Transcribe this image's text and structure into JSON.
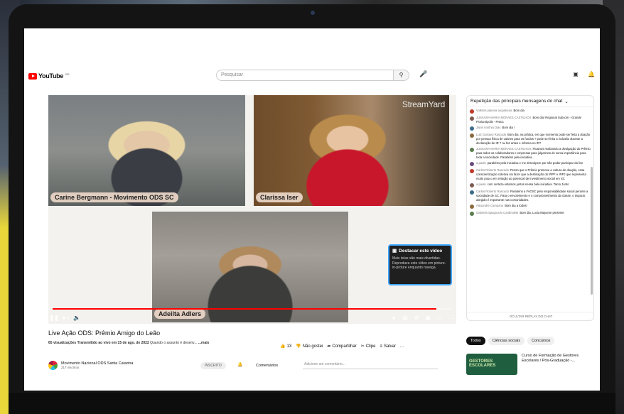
{
  "header": {
    "logo_text": "YouTube",
    "logo_region": "BR",
    "search_placeholder": "Pesquisar"
  },
  "player": {
    "participants": [
      {
        "name": "Carine Bergmann - Movimento ODS SC"
      },
      {
        "name": "Clarissa Iser"
      },
      {
        "name": "Adeilta Adlers"
      }
    ],
    "brand_watermark": "StreamYard",
    "progress_fraction": 0.96,
    "miniplayer_tip": {
      "title": "Destacar este vídeo",
      "body": "Mais telas são mais divertidas. Reproduza este vídeo em picture-in-picture enquanto navega."
    }
  },
  "chat": {
    "header": "Repetição das principais mensagens do chat",
    "messages": [
      {
        "author": "Volkmis planeta arquitetura",
        "text": "Bom dia"
      },
      {
        "author": "JUSSARA MARIA MORAES CASTILHOS",
        "text": "Bom dia! Regional Subcom - Grande Florianópolis - FNSC"
      },
      {
        "author": "Jamil Antônio Dias",
        "text": "Bom dia !"
      },
      {
        "author": "Luiz Gustavo Rascado",
        "text": "Bom dia, na prática, em que momento pode ser feita a doação por pessoa física de valores para os fundos ? pode ser feita a inclusão durante a declaração de IR ? ou faz antes e informa no IR?"
      },
      {
        "author": "JUSSARA MARIA MORAES CASTILHOS",
        "text": "Ficamos realizando a divulgação do Prêmio para todos os colaboradores e empresas para julgarmos de suma importância para toda a sociedade. Parabéns pela iniciativa."
      },
      {
        "author": "a paulo",
        "text": "parabéns pela iniciativa e me desculpem por não poder participar da live"
      },
      {
        "author": "Carlos Roberto Rascado",
        "text": "Penso que o Prêmio promove a cultura de doação, essa conscientização coletiva vai fazer que a destinação do IRPF e IRPJ que representa muito pouco em relação ao potencial de investimento social em SC"
      },
      {
        "author": "a paulo",
        "text": "com certeza estamos juntos nessa bela iniciativa. Tamo Junto"
      },
      {
        "author": "Carlos Roberto Rascado",
        "text": "Parabéns a FAOSC pela responsabilidade social perante a sociedade de SC. Para o envolvimento e o comprometimento da classe, o impacto atingido é importante nas comunidades."
      },
      {
        "author": "Alexandre Campana",
        "text": "Bom dia a todos!"
      },
      {
        "author": "Gabriela Spagnuolo Cardinaletti",
        "text": "Bom dia, Lucia Mayume presente"
      }
    ],
    "footer": "OCULTAR REPLAY DO CHAT"
  },
  "video": {
    "title": "Live Ação ODS: Prêmio Amigo do Leão",
    "views": "65 visualizações",
    "date": "Transmitido ao vivo em 15 de ago. de 2022",
    "description_snippet": "Quando o assunto é desenv...",
    "more_label": "...mais",
    "likes": "13",
    "dislike_label": "Não gostei",
    "share_label": "Compartilhar",
    "clip_label": "Clipe",
    "save_label": "Salvar",
    "more_actions": "..."
  },
  "channel": {
    "name": "Movimento Nacional ODS Santa Catarina",
    "subscribers": "217 inscritos",
    "subscribe_label": "INSCRITO",
    "comments_label": "Comentários",
    "comment_placeholder": "Adicione um comentário..."
  },
  "sidebar": {
    "chips": [
      "Todos",
      "Ciências sociais",
      "Concursos"
    ],
    "recommended": {
      "thumb_text": "GESTORES ESCOLARES",
      "title": "Curso de Formação de Gestores Escolares / Pós-Graduação -..."
    }
  },
  "colors": {
    "youtube_red": "#ff0000",
    "chip_active": "#111111",
    "tip_border": "#3ea6ff"
  }
}
